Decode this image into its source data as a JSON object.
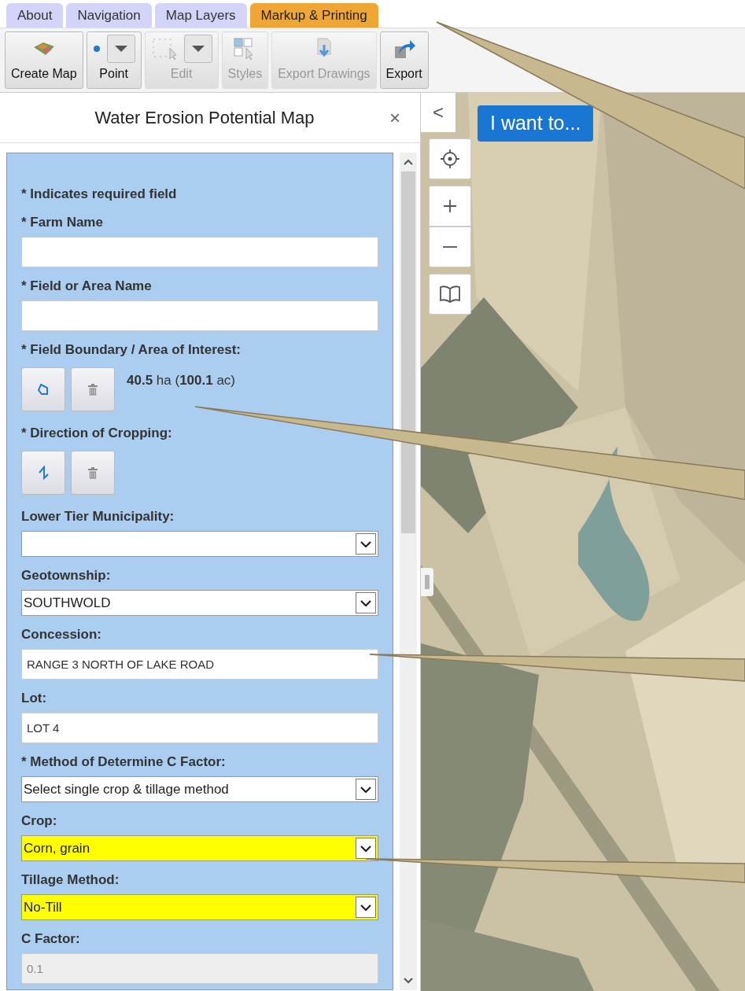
{
  "tabs": [
    {
      "label": "About",
      "selected": false
    },
    {
      "label": "Navigation",
      "selected": false
    },
    {
      "label": "Map Layers",
      "selected": false
    },
    {
      "label": "Markup & Printing",
      "selected": true
    }
  ],
  "toolbar": [
    {
      "label": "Create Map",
      "disabled": false,
      "dropdown": false
    },
    {
      "label": "Point",
      "disabled": false,
      "dropdown": true
    },
    {
      "label": "Edit",
      "disabled": true,
      "dropdown": true
    },
    {
      "label": "Styles",
      "disabled": true,
      "dropdown": false
    },
    {
      "label": "Export Drawings",
      "disabled": true,
      "dropdown": false
    },
    {
      "label": "Export",
      "disabled": false,
      "dropdown": false
    }
  ],
  "panel": {
    "title": "Water Erosion Potential Map",
    "close": "×",
    "note": "* Indicates required field",
    "fields": [
      {
        "kind": "text",
        "label": "* Farm Name",
        "highlighted": false,
        "disabled": false
      },
      {
        "kind": "text",
        "label": "* Field or Area Name",
        "highlighted": false,
        "disabled": false
      },
      {
        "kind": "draw",
        "label": "* Field Boundary / Area of Interest:",
        "measurement": "**40.5** ha (**100.1** ac)"
      },
      {
        "kind": "draw",
        "label": "* Direction of Cropping:"
      },
      {
        "kind": "select",
        "label": "Lower Tier Municipality:",
        "highlighted": false,
        "disabled": false
      },
      {
        "kind": "select",
        "label": "Geotownship:",
        "value": "SOUTHWOLD",
        "highlighted": false,
        "disabled": false
      },
      {
        "kind": "text",
        "label": "Concession:",
        "value": "RANGE 3 NORTH OF LAKE ROAD",
        "highlighted": false,
        "disabled": false
      },
      {
        "kind": "text",
        "label": "Lot:",
        "value": "LOT 4",
        "highlighted": false,
        "disabled": false
      },
      {
        "kind": "select",
        "label": "* Method of Determine C Factor:",
        "value": "Select single crop & tillage method",
        "highlighted": false,
        "disabled": false
      },
      {
        "kind": "select",
        "label": "Crop:",
        "value": "Corn, grain",
        "highlighted": true,
        "disabled": false
      },
      {
        "kind": "select",
        "label": "Tillage Method:",
        "value": "No-Till",
        "highlighted": true,
        "disabled": false
      },
      {
        "kind": "text",
        "label": "C Factor:",
        "value": "0.1",
        "highlighted": false,
        "disabled": true
      }
    ]
  },
  "map": {
    "collapse": "<",
    "menu_button": "I want to..."
  }
}
